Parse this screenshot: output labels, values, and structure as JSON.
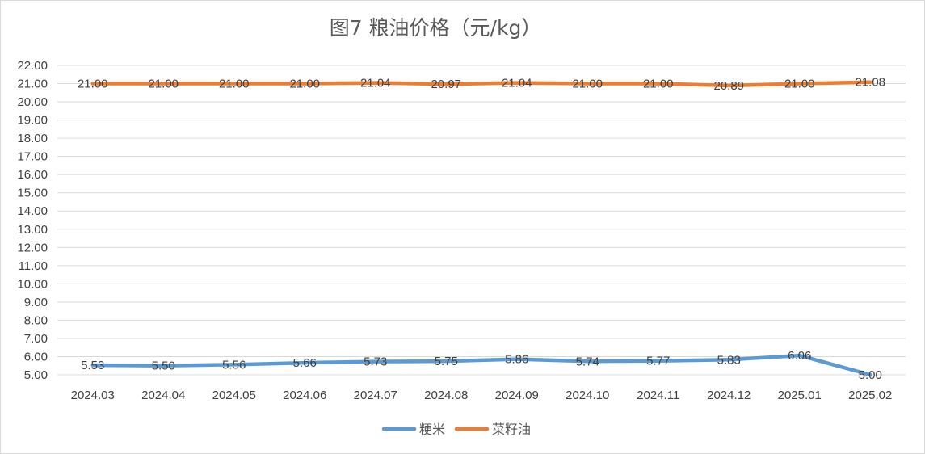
{
  "chart_data": {
    "type": "line",
    "title": "图7  粮油价格（元/kg）",
    "xlabel": "",
    "ylabel": "",
    "categories": [
      "2024.03",
      "2024.04",
      "2024.05",
      "2024.06",
      "2024.07",
      "2024.08",
      "2024.09",
      "2024.10",
      "2024.11",
      "2024.12",
      "2025.01",
      "2025.02"
    ],
    "ylim": [
      5.0,
      22.0
    ],
    "ystep": 1.0,
    "grid": true,
    "legend_position": "bottom",
    "series": [
      {
        "name": "粳米",
        "color": "#5b9bd5",
        "values": [
          5.53,
          5.5,
          5.56,
          5.66,
          5.73,
          5.75,
          5.86,
          5.74,
          5.77,
          5.83,
          6.06,
          5.0
        ],
        "labels": [
          "5.53",
          "5.50",
          "5.56",
          "5.66",
          "5.73",
          "5.75",
          "5.86",
          "5.74",
          "5.77",
          "5.83",
          "6.06",
          "5.00"
        ]
      },
      {
        "name": "菜籽油",
        "color": "#ed7d31",
        "values": [
          21.0,
          21.0,
          21.0,
          21.0,
          21.04,
          20.97,
          21.04,
          21.0,
          21.0,
          20.89,
          21.0,
          21.08
        ],
        "labels": [
          "21.00",
          "21.00",
          "21.00",
          "21.00",
          "21.04",
          "20.97",
          "21.04",
          "21.00",
          "21.00",
          "20.89",
          "21.00",
          "21.08"
        ]
      }
    ]
  }
}
